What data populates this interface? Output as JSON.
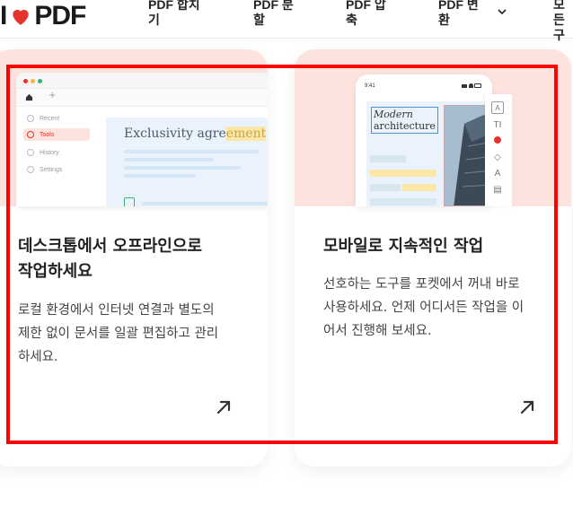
{
  "header": {
    "logo": {
      "i": "I",
      "pdf": "PDF"
    },
    "nav": [
      {
        "line1": "PDF 합치",
        "line2": "기"
      },
      {
        "line1": "PDF 분",
        "line2": "할"
      },
      {
        "line1": "PDF 압",
        "line2": "축"
      },
      {
        "line1": "PDF 변",
        "line2": "환"
      },
      {
        "line1": "모든",
        "line2": "구"
      }
    ]
  },
  "cards": [
    {
      "title_line1": "데스크톱에서 오프라인으로",
      "title_line2": "작업하세요",
      "desc_line1": "로컬 환경에서 인터넷 연결과 별도의",
      "desc_line2": "제한 없이 문서를 일괄 편집하고 관리",
      "desc_line3": "하세요.",
      "mock": {
        "side_items": [
          "Recent",
          "Tools",
          "History",
          "Settings"
        ],
        "doc_title": "Exclusivity agre",
        "doc_title_hl": "ement"
      }
    },
    {
      "title_line1": "모바일로 지속적인 작업",
      "desc_line1": "선호하는 도구를 포켓에서 꺼내 바로",
      "desc_line2": "사용하세요. 언제 어디서든 작업을 이",
      "desc_line3": "어서 진행해 보세요.",
      "mock": {
        "time": "9:41",
        "modern": "Modern",
        "architecture": "architecture"
      }
    }
  ],
  "colors": {
    "brand_red": "#e5322d",
    "hero_bg": "#fde3de",
    "highlight": "#ff0000"
  }
}
